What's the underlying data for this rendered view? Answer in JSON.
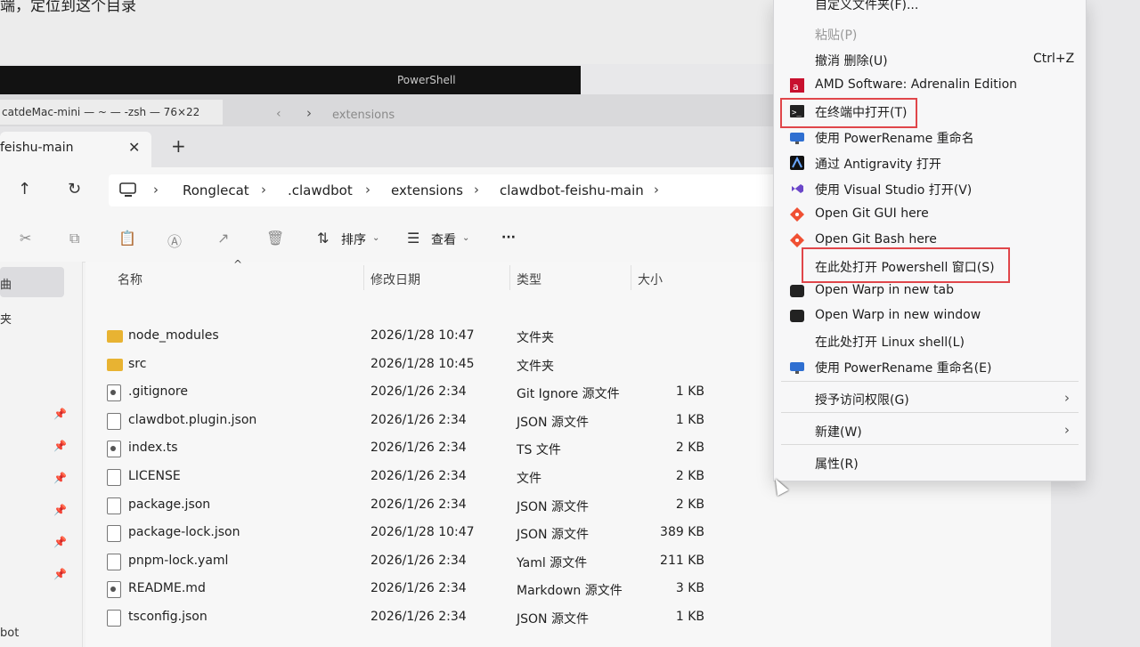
{
  "top": {
    "doc_text": "端，定位到这个目录",
    "ps_title": "PowerShell",
    "term_tab": "catdeMac-mini — ~ — -zsh — 76×22",
    "term_path": "extensions"
  },
  "explorer": {
    "tab_title": "feishu-main",
    "tab_close": "✕",
    "tab_add": "+",
    "breadcrumb": [
      "Ronglecat",
      ".clawdbot",
      "extensions",
      "clawdbot-feishu-main"
    ],
    "toolbar": {
      "sort_label": "排序",
      "view_label": "查看",
      "more_label": "···"
    },
    "sidebar": {
      "selected_label": "曲",
      "item2_label": "夹",
      "bottom_label": "bot"
    },
    "columns": {
      "name": "名称",
      "date": "修改日期",
      "type": "类型",
      "size": "大小"
    },
    "files": [
      {
        "name": "node_modules",
        "date": "2026/1/28 10:47",
        "type": "文件夹",
        "size": "",
        "icon": "folder"
      },
      {
        "name": "src",
        "date": "2026/1/28 10:45",
        "type": "文件夹",
        "size": "",
        "icon": "folder"
      },
      {
        "name": ".gitignore",
        "date": "2026/1/26 2:34",
        "type": "Git Ignore 源文件",
        "size": "1 KB",
        "icon": "gear"
      },
      {
        "name": "clawdbot.plugin.json",
        "date": "2026/1/26 2:34",
        "type": "JSON 源文件",
        "size": "1 KB",
        "icon": "file"
      },
      {
        "name": "index.ts",
        "date": "2026/1/26 2:34",
        "type": "TS 文件",
        "size": "2 KB",
        "icon": "gear"
      },
      {
        "name": "LICENSE",
        "date": "2026/1/26 2:34",
        "type": "文件",
        "size": "2 KB",
        "icon": "file"
      },
      {
        "name": "package.json",
        "date": "2026/1/26 2:34",
        "type": "JSON 源文件",
        "size": "2 KB",
        "icon": "file"
      },
      {
        "name": "package-lock.json",
        "date": "2026/1/28 10:47",
        "type": "JSON 源文件",
        "size": "389 KB",
        "icon": "file"
      },
      {
        "name": "pnpm-lock.yaml",
        "date": "2026/1/26 2:34",
        "type": "Yaml 源文件",
        "size": "211 KB",
        "icon": "file"
      },
      {
        "name": "README.md",
        "date": "2026/1/26 2:34",
        "type": "Markdown 源文件",
        "size": "3 KB",
        "icon": "gear"
      },
      {
        "name": "tsconfig.json",
        "date": "2026/1/26 2:34",
        "type": "JSON 源文件",
        "size": "1 KB",
        "icon": "file"
      }
    ]
  },
  "context_menu": {
    "top_partial": "自定义文件夹(F)...",
    "paste": "粘贴(P)",
    "undo": "撤消 删除(U)",
    "undo_shortcut": "Ctrl+Z",
    "amd": "AMD Software: Adrenalin Edition",
    "open_terminal": "在终端中打开(T)",
    "powerrename": "使用 PowerRename 重命名",
    "antigravity": "通过 Antigravity 打开",
    "visual_studio": "使用 Visual Studio 打开(V)",
    "git_gui": "Open Git GUI here",
    "git_bash": "Open Git Bash here",
    "powershell": "在此处打开 Powershell 窗口(S)",
    "warp_tab": "Open Warp in new tab",
    "warp_window": "Open Warp in new window",
    "linux_shell": "在此处打开 Linux shell(L)",
    "powerrename2": "使用 PowerRename 重命名(E)",
    "grant_access": "授予访问权限(G)",
    "new": "新建(W)",
    "properties": "属性(R)",
    "arrow": "›"
  },
  "colors": {
    "highlight": "#e0464a",
    "folder": "#e8b332"
  }
}
